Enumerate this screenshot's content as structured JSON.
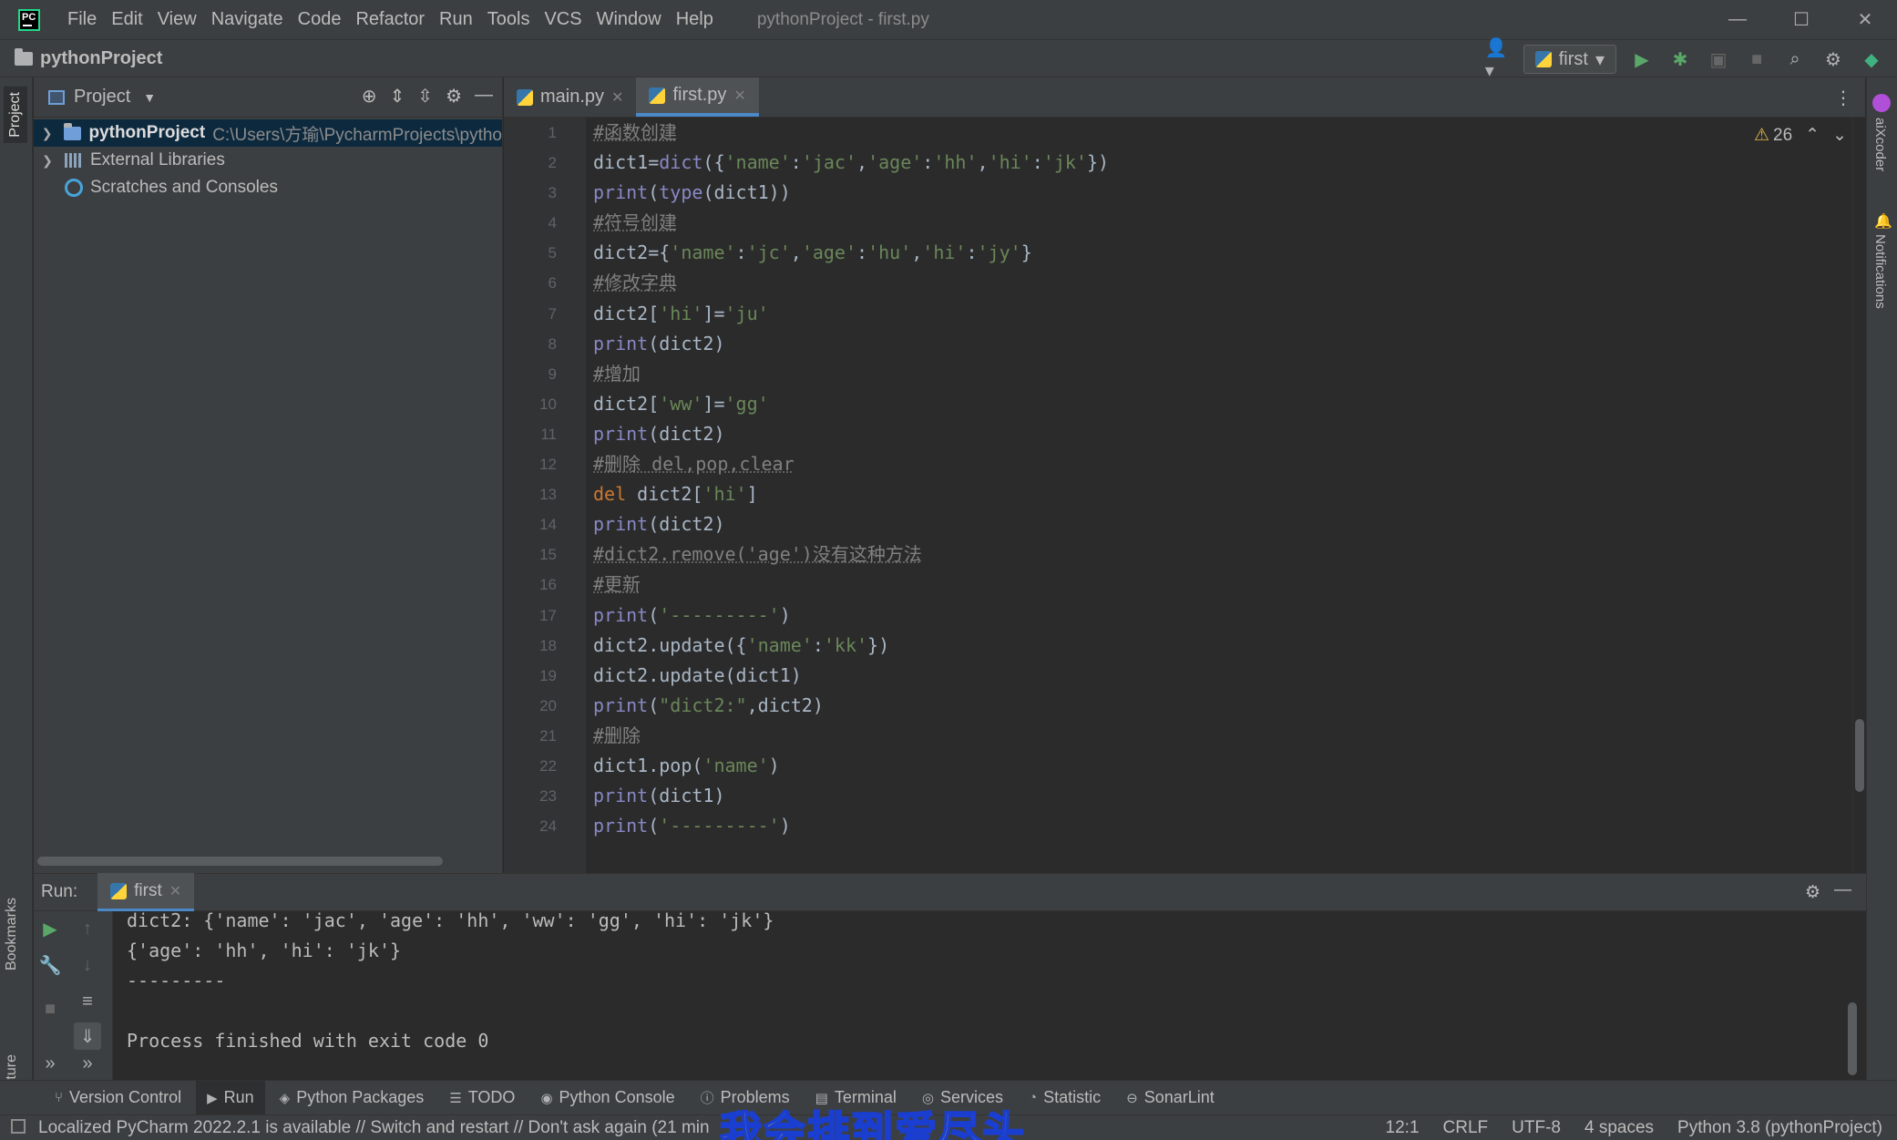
{
  "window": {
    "title": "pythonProject - first.py",
    "logo_text": "PC",
    "menu": [
      "File",
      "Edit",
      "View",
      "Navigate",
      "Code",
      "Refactor",
      "Run",
      "Tools",
      "VCS",
      "Window",
      "Help"
    ]
  },
  "navbar": {
    "project_name": "pythonProject",
    "run_config": "first"
  },
  "project_panel": {
    "title": "Project",
    "tree": [
      {
        "label": "pythonProject",
        "path": "C:\\Users\\方瑜\\PycharmProjects\\pytho"
      },
      {
        "label": "External Libraries"
      },
      {
        "label": "Scratches and Consoles"
      }
    ]
  },
  "left_strip": {
    "project": "Project",
    "bookmarks": "Bookmarks",
    "structure": "Structure"
  },
  "right_strip": {
    "aixcoder": "aiXcoder",
    "notifications": "Notifications"
  },
  "editor": {
    "tabs": [
      {
        "label": "main.py",
        "active": false
      },
      {
        "label": "first.py",
        "active": true
      }
    ],
    "warning_count": "26",
    "line_numbers": [
      "1",
      "2",
      "3",
      "4",
      "5",
      "6",
      "7",
      "8",
      "9",
      "10",
      "11",
      "12",
      "13",
      "14",
      "15",
      "16",
      "17",
      "18",
      "19",
      "20",
      "21",
      "22",
      "23",
      "24"
    ],
    "lines": [
      "#函数创建",
      "dict1=dict({'name':'jac','age':'hh','hi':'jk'})",
      "print(type(dict1))",
      "#符号创建",
      "dict2={'name':'jc','age':'hu','hi':'jy'}",
      "#修改字典",
      "dict2['hi']='ju'",
      "print(dict2)",
      "#增加",
      "dict2['ww']='gg'",
      "print(dict2)",
      "#删除 del,pop,clear",
      "del dict2['hi']",
      "print(dict2)",
      "#dict2.remove('age')没有这种方法",
      "#更新",
      "print('---------')",
      "dict2.update({'name':'kk'})",
      "dict2.update(dict1)",
      "print(\"dict2:\",dict2)",
      "#删除",
      "dict1.pop('name')",
      "print(dict1)",
      "print('---------')"
    ]
  },
  "run_panel": {
    "label": "Run:",
    "tab": "first",
    "output": [
      "dict2: {'name': 'jac', 'age': 'hh', 'ww': 'gg', 'hi': 'jk'}",
      "{'age': 'hh', 'hi': 'jk'}",
      "---------",
      "",
      "Process finished with exit code 0"
    ]
  },
  "tool_windows": [
    "Version Control",
    "Run",
    "Python Packages",
    "TODO",
    "Python Console",
    "Problems",
    "Terminal",
    "Services",
    "Statistic",
    "SonarLint"
  ],
  "status": {
    "message": "Localized PyCharm 2022.2.1 is available // Switch and restart // Don't ask again (21 min",
    "position": "12:1",
    "line_sep": "CRLF",
    "encoding": "UTF-8",
    "indent": "4 spaces",
    "interpreter": "Python 3.8 (pythonProject)"
  },
  "overlay_subtitle": "我会排到爱尽头"
}
